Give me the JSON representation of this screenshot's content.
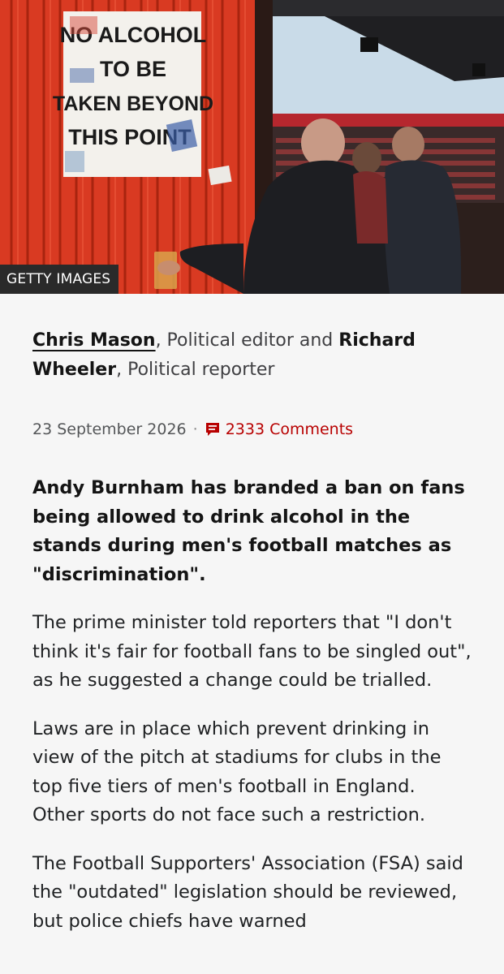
{
  "hero": {
    "credit": "GETTY IMAGES",
    "sign_lines": [
      "NO ALCOHOL",
      "TO BE",
      "TAKEN BEYOND",
      "THIS POINT"
    ]
  },
  "byline": {
    "author1": "Chris Mason",
    "role1": ", Political editor and ",
    "author2": "Richard Wheeler",
    "role2": ", Political reporter"
  },
  "meta": {
    "date": "23 September 2026",
    "separator": "·",
    "comments": "2333 Comments",
    "comment_icon": "comment-icon"
  },
  "body": {
    "lead": "Andy Burnham has branded a ban on fans being allowed to drink alcohol in the stands during men's football matches as \"discrimination\".",
    "paragraphs": [
      "The prime minister told reporters that \"I don't think it's fair for football fans to be singled out\", as he suggested a change could be trialled.",
      "Laws are in place which prevent drinking in view of the pitch at stadiums for clubs in the top five tiers of men's football in England. Other sports do not face such a restriction.",
      "The Football Supporters' Association (FSA) said the \"outdated\" legislation should be reviewed, but police chiefs have warned"
    ]
  },
  "colors": {
    "accent_red": "#b80000",
    "background": "#f6f6f6"
  }
}
